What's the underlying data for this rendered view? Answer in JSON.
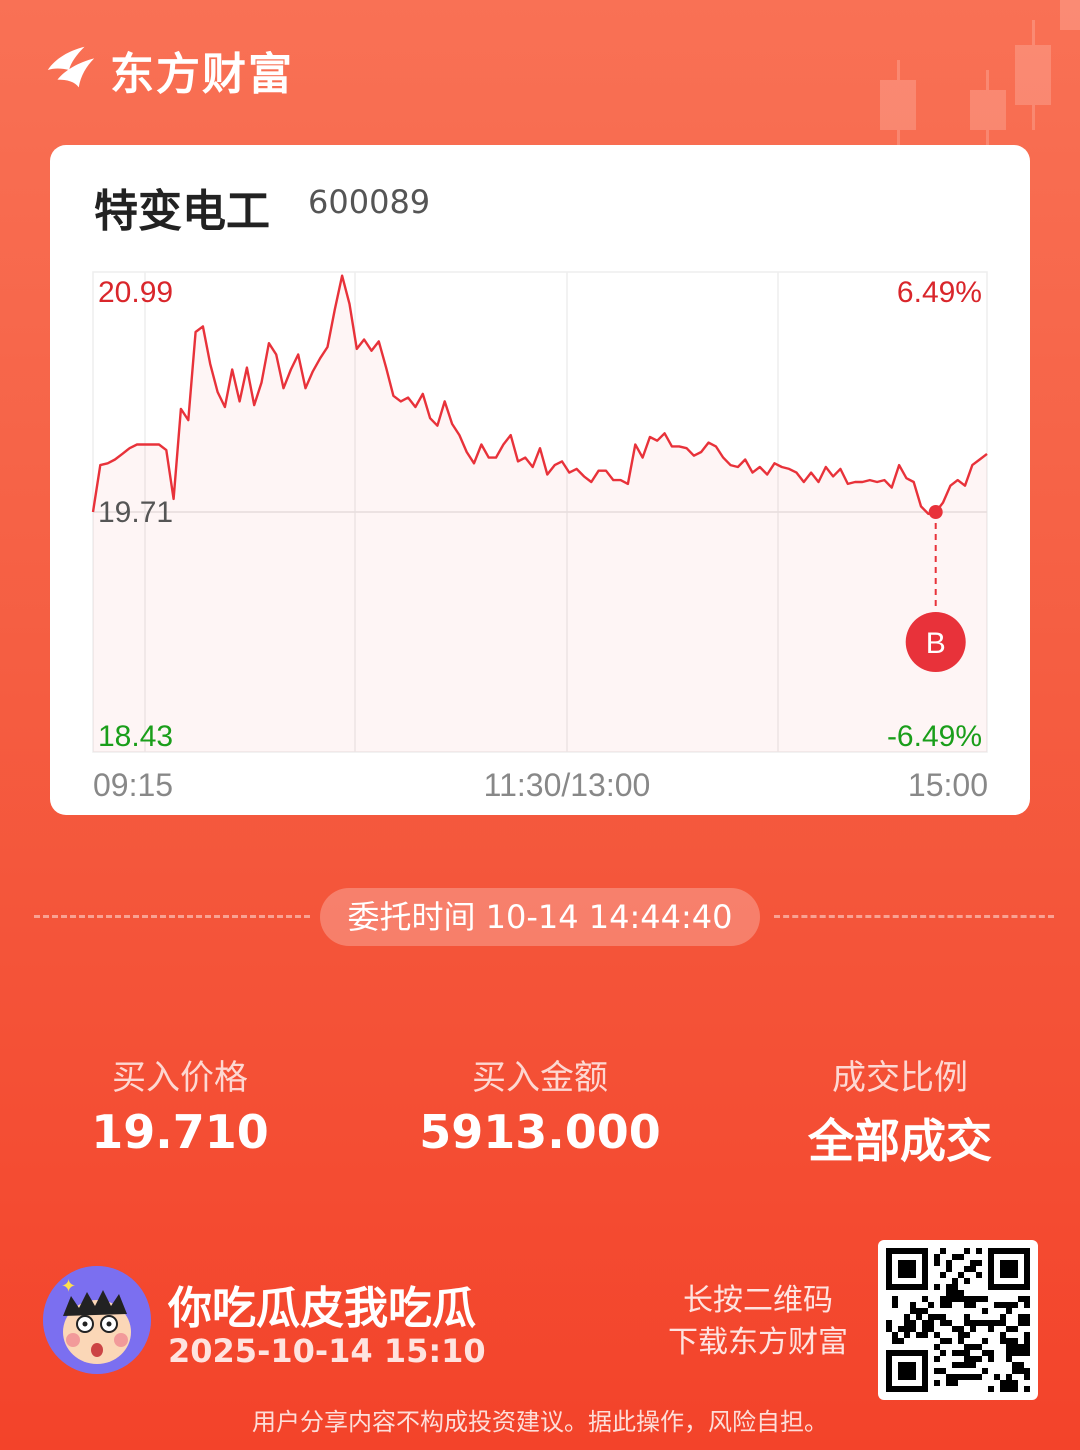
{
  "brand": {
    "name": "东方财富",
    "logo_icon": "eastmoney-logo-icon"
  },
  "stock": {
    "name": "特变电工",
    "code": "600089"
  },
  "chart_data": {
    "type": "line",
    "y_labels": {
      "high": "20.99",
      "mid": "19.71",
      "low": "18.43"
    },
    "pct_labels": {
      "high": "6.49%",
      "low": "-6.49%"
    },
    "x_labels": {
      "start": "09:15",
      "mid": "11:30/13:00",
      "end": "15:00"
    },
    "ylim": [
      18.43,
      20.99
    ],
    "prev_close": 19.71,
    "series": [
      {
        "values": [
          19.71,
          19.96,
          19.97,
          19.99,
          20.02,
          20.05,
          20.07,
          20.07,
          20.07,
          20.07,
          20.04,
          19.78,
          20.26,
          20.2,
          20.67,
          20.7,
          20.5,
          20.35,
          20.27,
          20.47,
          20.3,
          20.48,
          20.28,
          20.4,
          20.61,
          20.55,
          20.37,
          20.47,
          20.55,
          20.37,
          20.46,
          20.53,
          20.59,
          20.79,
          20.97,
          20.82,
          20.58,
          20.63,
          20.57,
          20.62,
          20.48,
          20.33,
          20.3,
          20.32,
          20.27,
          20.34,
          20.21,
          20.17,
          20.3,
          20.18,
          20.12,
          20.03,
          19.97,
          20.07,
          20.0,
          20.0,
          20.07,
          20.12,
          19.98,
          20.0,
          19.95,
          20.05,
          19.91,
          19.96,
          19.98,
          19.92,
          19.94,
          19.9,
          19.87,
          19.93,
          19.93,
          19.88,
          19.88,
          19.86,
          20.07,
          20.0,
          20.11,
          20.09,
          20.13,
          20.06,
          20.06,
          20.05,
          20.01,
          20.03,
          20.08,
          20.06,
          20.0,
          19.96,
          19.95,
          19.99,
          19.92,
          19.95,
          19.91,
          19.97,
          19.95,
          19.94,
          19.92,
          19.87,
          19.92,
          19.87,
          19.95,
          19.9,
          19.94,
          19.86,
          19.87,
          19.87,
          19.88,
          19.87,
          19.88,
          19.84,
          19.96,
          19.89,
          19.87,
          19.74,
          19.7,
          19.71,
          19.76,
          19.85,
          19.88,
          19.85,
          19.96,
          19.99,
          20.02
        ],
        "marker": {
          "index": 115,
          "label": "B",
          "price": 19.71
        }
      }
    ],
    "grid": true
  },
  "order_time": "委托时间 10-14 14:44:40",
  "stats": [
    {
      "label": "买入价格",
      "value": "19.710"
    },
    {
      "label": "买入金额",
      "value": "5913.000"
    },
    {
      "label": "成交比例",
      "value": "全部成交"
    }
  ],
  "user": {
    "name": "你吃瓜皮我吃瓜",
    "time": "2025-10-14 15:10",
    "avatar_icon": "cartoon-avatar-icon"
  },
  "qr": {
    "line1": "长按二维码",
    "line2": "下载东方财富",
    "icon": "qr-code-icon"
  },
  "disclaimer": "用户分享内容不构成投资建议。据此操作，风险自担。",
  "colors": {
    "up": "#e0262a",
    "down": "#1a9e1a",
    "neutral": "#555555",
    "line": "#e8323a"
  }
}
